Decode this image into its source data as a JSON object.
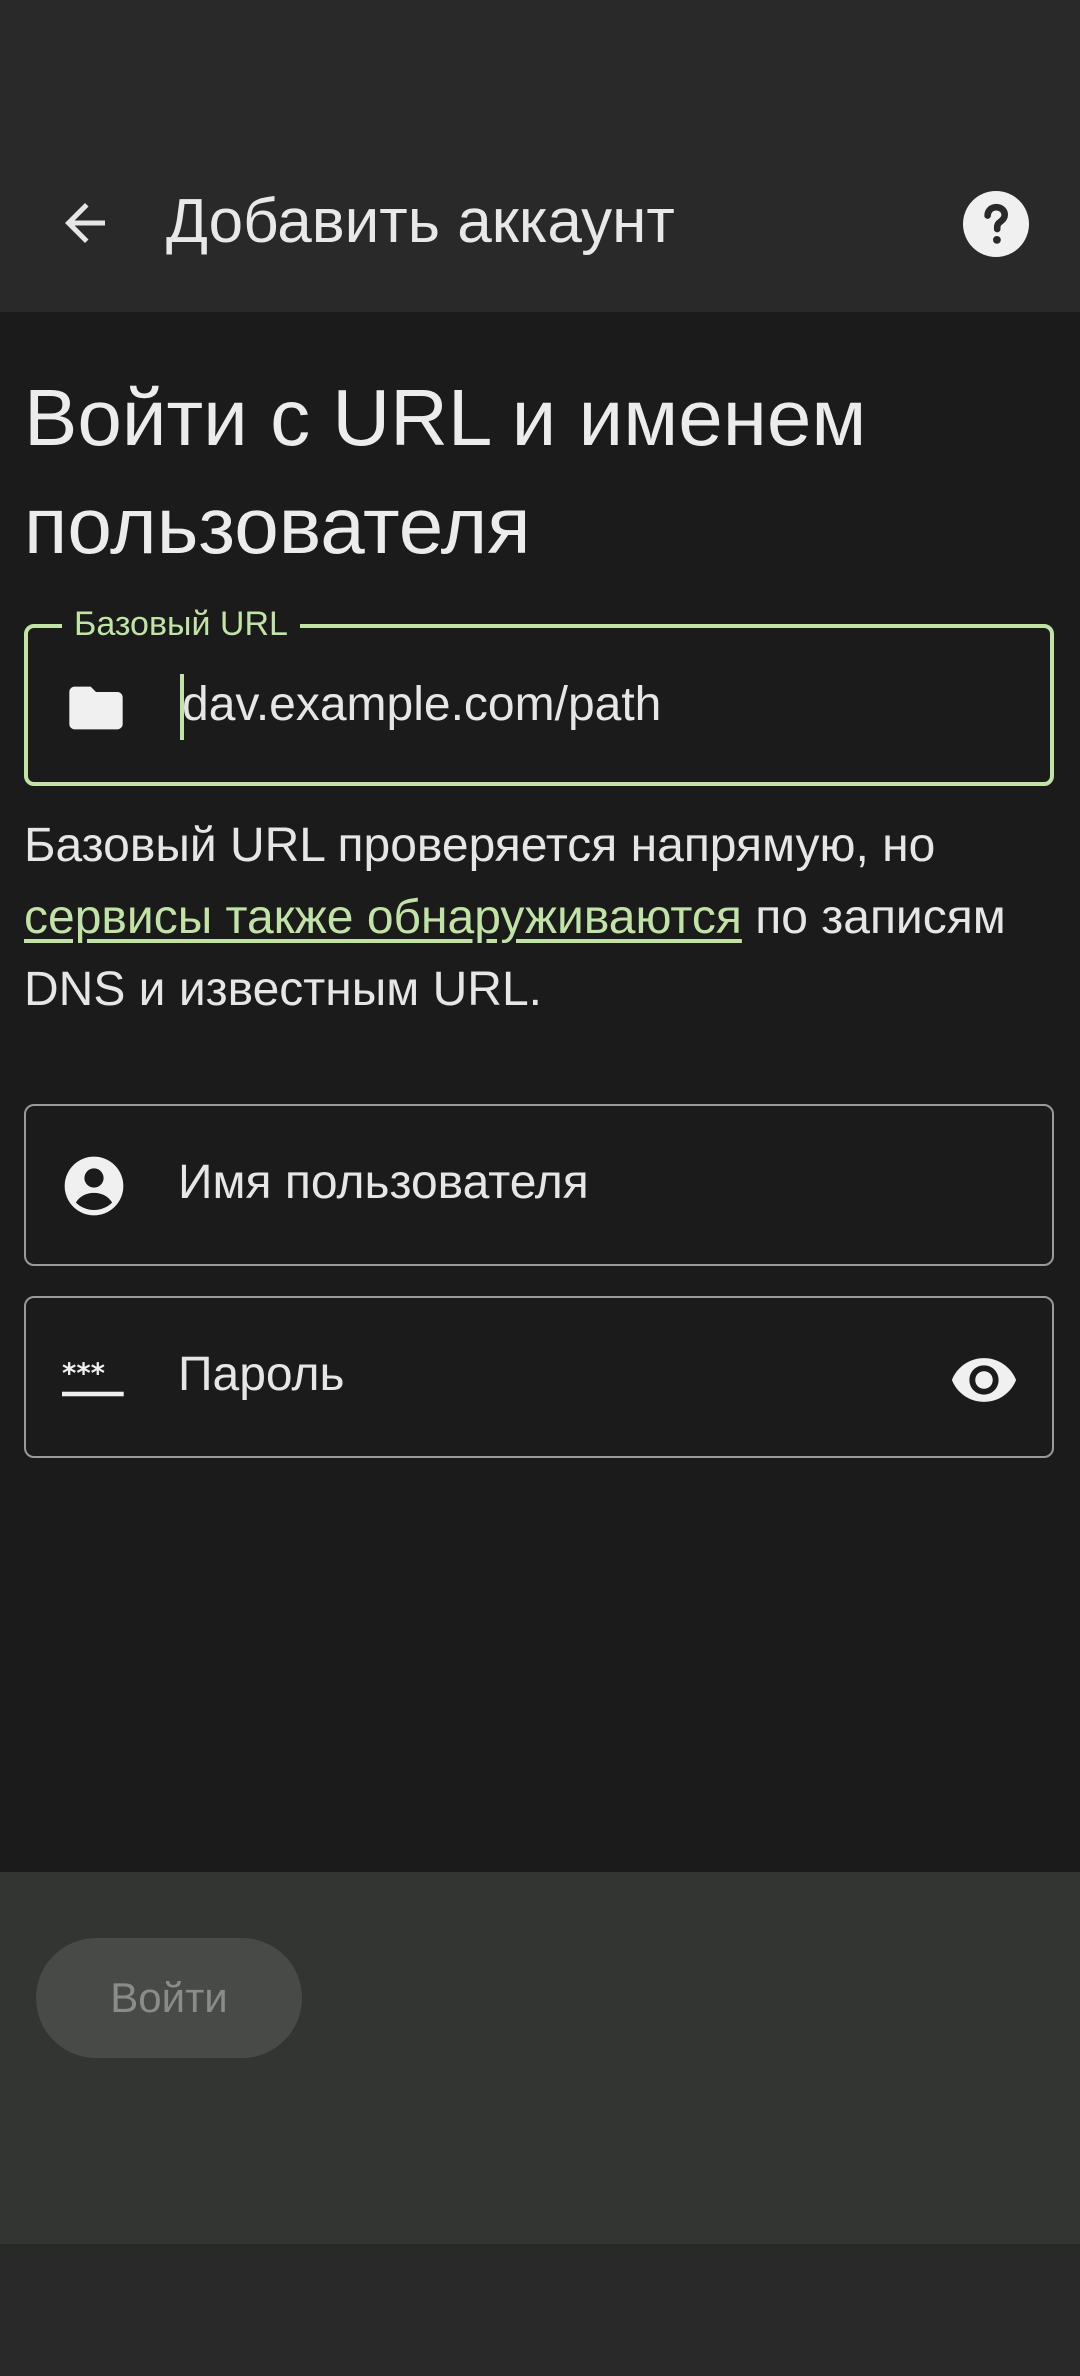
{
  "app_bar": {
    "title": "Добавить аккаунт",
    "back_icon": "arrow-back-icon",
    "help_icon": "help-icon"
  },
  "main": {
    "heading": "Войти с URL и именем пользователя",
    "url_field": {
      "label": "Базовый URL",
      "value": "dav.example.com/path",
      "icon": "folder-icon"
    },
    "help": {
      "prefix": "Базовый URL проверяется напрямую, но ",
      "link": "сервисы также обнаруживаются",
      "suffix": " по записям DNS и известным URL."
    },
    "username_field": {
      "placeholder": "Имя пользователя",
      "icon": "account-circle-icon"
    },
    "password_field": {
      "placeholder": "Пароль",
      "icon": "password-icon",
      "toggle_icon": "eye-icon"
    }
  },
  "footer": {
    "login_label": "Войти"
  },
  "colors": {
    "accent": "#c1e3a6",
    "background": "#1b1b1b",
    "bar": "#292929",
    "bottom_panel": "#333532"
  }
}
